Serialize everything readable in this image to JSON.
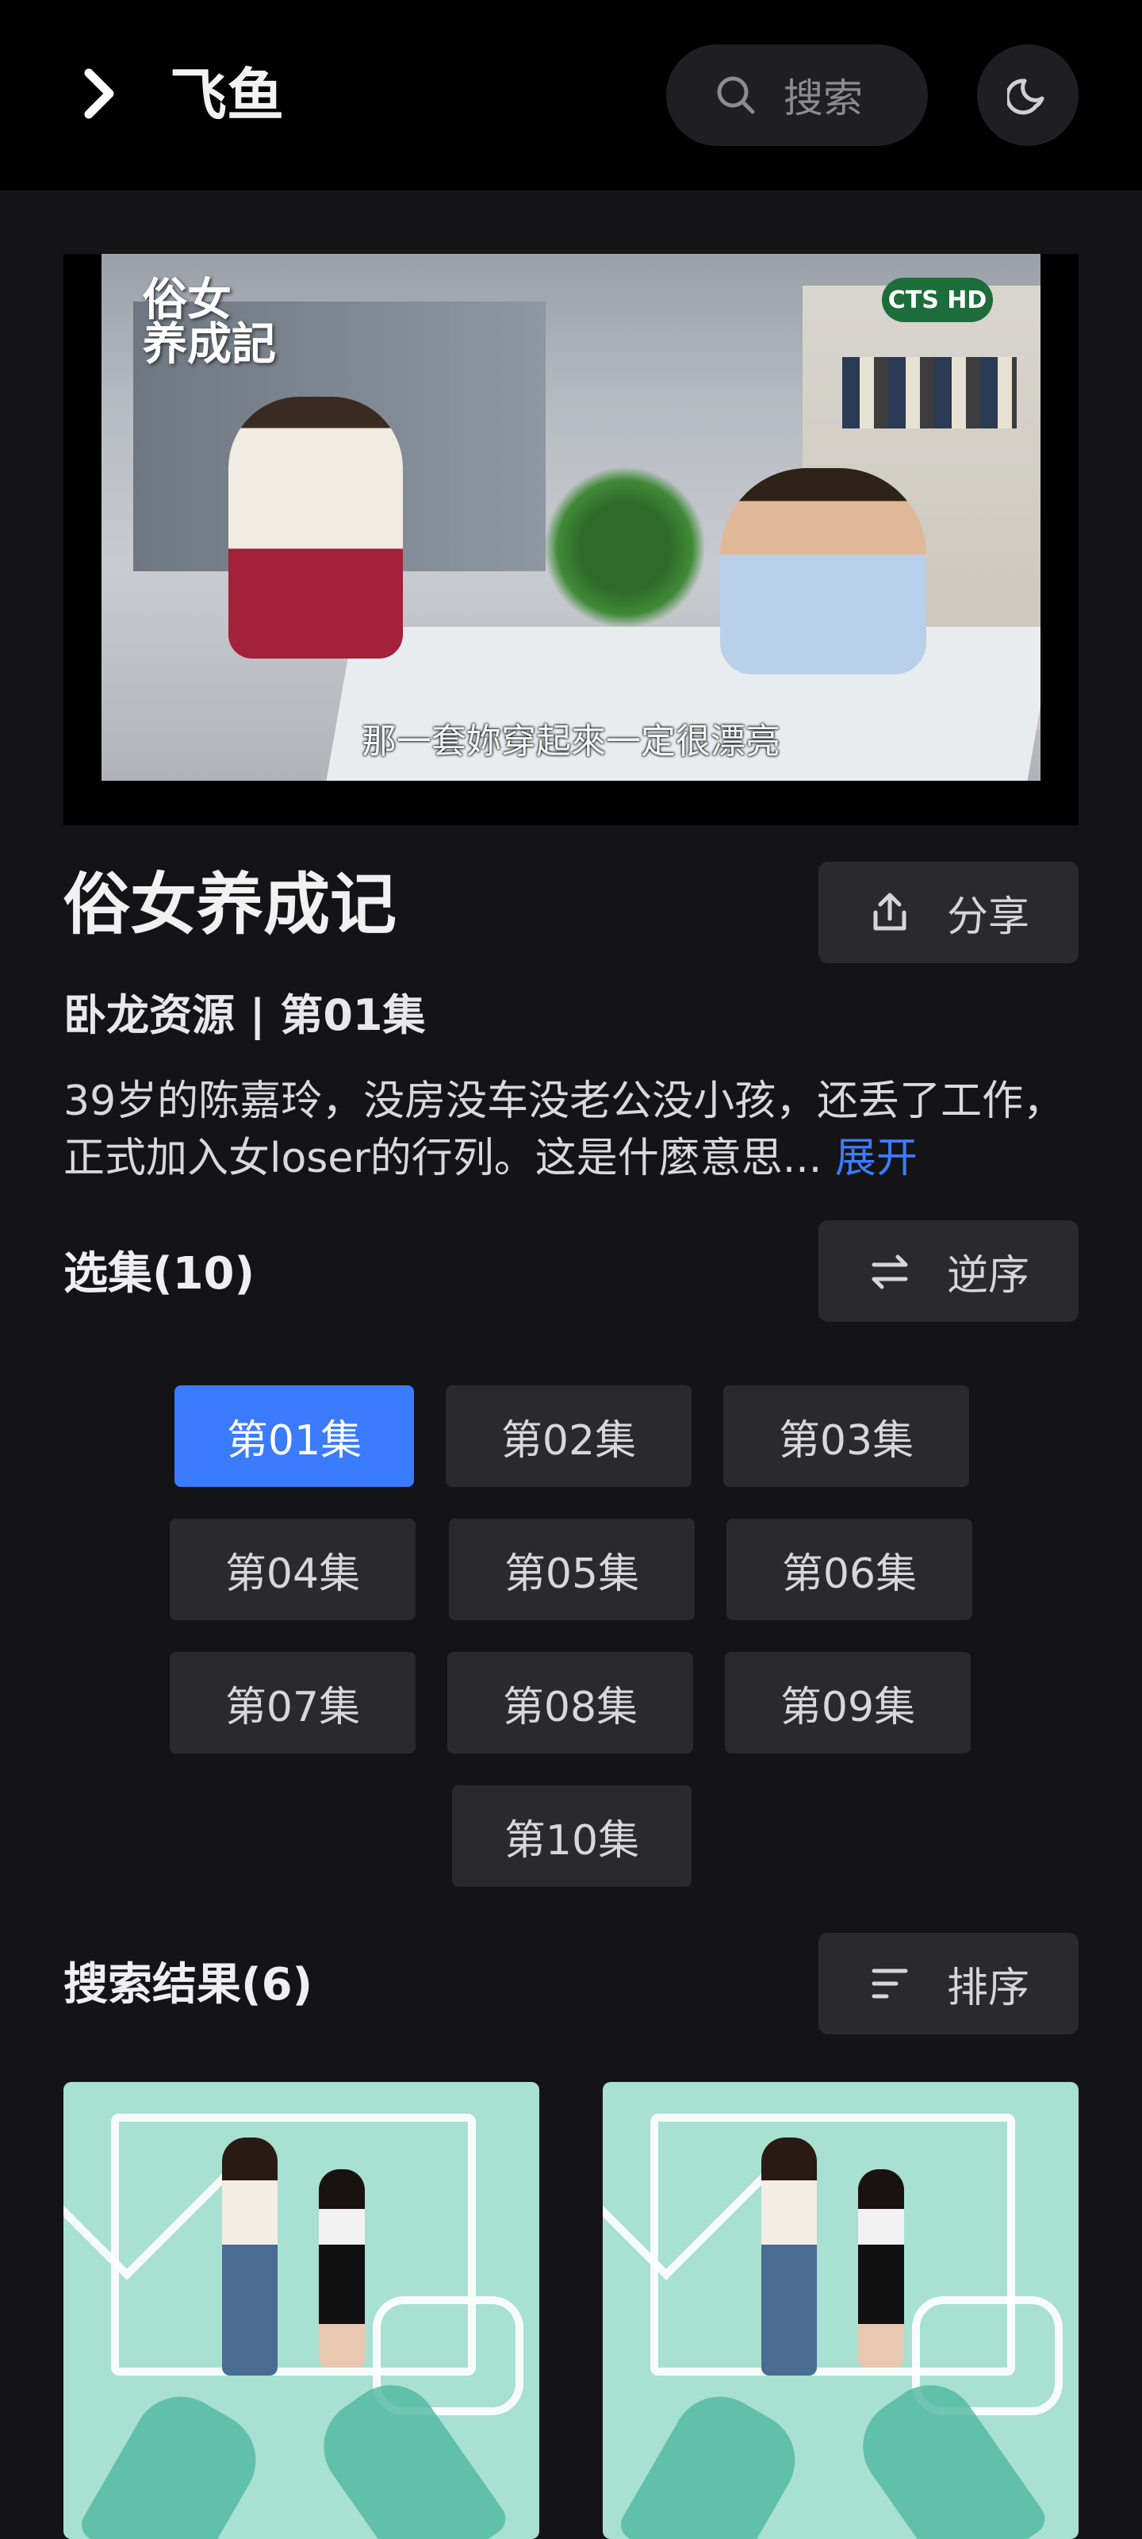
{
  "header": {
    "back_icon": "chevron-right-icon",
    "app_title": "飞鱼",
    "search_placeholder": "搜索",
    "theme_icon": "moon-icon"
  },
  "player": {
    "overlay_logo": "俗女\n养成記",
    "channel_badge": "CTS HD",
    "subtitle": "那一套妳穿起來一定很漂亮"
  },
  "show": {
    "title": "俗女养成记",
    "share_label": "分享",
    "meta": "卧龙资源 | 第01集",
    "description": "39岁的陈嘉玲，没房没车没老公没小孩，还丢了工作，正式加入女loser的行列。这是什麼意思...",
    "expand_label": "展开"
  },
  "episodes": {
    "section_title": "选集(10)",
    "sort_label": "逆序",
    "items": [
      "第01集",
      "第02集",
      "第03集",
      "第04集",
      "第05集",
      "第06集",
      "第07集",
      "第08集",
      "第09集",
      "第10集"
    ],
    "selected": "第01集"
  },
  "results": {
    "section_title": "搜索结果(6)",
    "sort_label": "排序"
  },
  "colors": {
    "accent": "#3a7bff",
    "background": "#141416",
    "header": "#000000",
    "button": "#2a2a2d"
  }
}
